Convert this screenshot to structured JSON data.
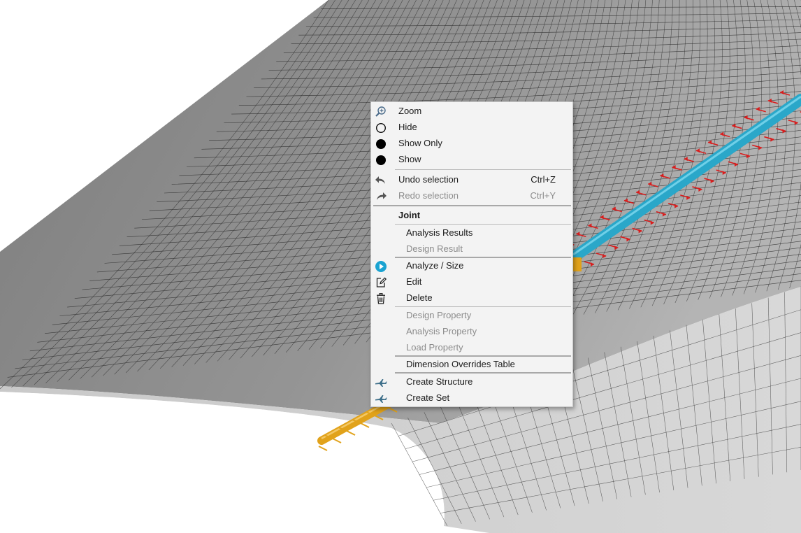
{
  "context_menu": {
    "items": [
      {
        "label": "Zoom",
        "icon": "zoom-in-icon",
        "enabled": true
      },
      {
        "label": "Hide",
        "icon": "hollow-circle-icon",
        "enabled": true
      },
      {
        "label": "Show Only",
        "icon": "filled-circle-icon",
        "enabled": true
      },
      {
        "label": "Show",
        "icon": "filled-circle-icon",
        "enabled": true
      },
      {
        "label": "Undo selection",
        "shortcut": "Ctrl+Z",
        "icon": "undo-icon",
        "enabled": true
      },
      {
        "label": "Redo selection",
        "shortcut": "Ctrl+Y",
        "icon": "redo-icon",
        "enabled": false
      },
      {
        "label": "Joint",
        "header": true
      },
      {
        "label": "Analysis Results",
        "enabled": true
      },
      {
        "label": "Design Result",
        "enabled": false
      },
      {
        "label": "Analyze / Size",
        "icon": "play-icon",
        "enabled": true
      },
      {
        "label": "Edit",
        "icon": "edit-icon",
        "enabled": true
      },
      {
        "label": "Delete",
        "icon": "trash-icon",
        "enabled": true
      },
      {
        "label": "Design Property",
        "enabled": false
      },
      {
        "label": "Analysis Property",
        "enabled": false
      },
      {
        "label": "Load Property",
        "enabled": false
      },
      {
        "label": "Dimension Overrides Table",
        "enabled": true
      },
      {
        "label": "Create Structure",
        "icon": "aircraft-icon",
        "enabled": true
      },
      {
        "label": "Create Set",
        "icon": "aircraft-icon",
        "enabled": true
      }
    ]
  },
  "colors": {
    "mesh_surface": "#8f8f8f",
    "mesh_lines": "#2b2b2b",
    "joint_blue": "#2aa7c9",
    "joint_orange": "#e1a21a",
    "load_arrows": "#d81d1d",
    "play_icon": "#1aa3d1"
  }
}
